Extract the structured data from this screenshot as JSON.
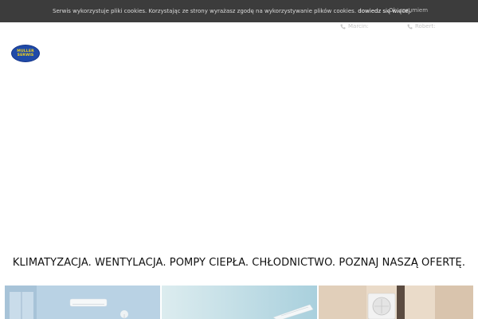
{
  "cookie_bar": {
    "text": "Serwis wykorzystuje pliki cookies. Korzystając ze strony wyrażasz zgodę na wykorzystywanie plików cookies.",
    "link_label": "dowiedz się więcej.",
    "ok_label": "Ok, rozumiem"
  },
  "header": {
    "logo_line1": "MULLER",
    "logo_line2": "SERWIS",
    "contacts": [
      {
        "label": "Marcin:"
      },
      {
        "label": "Robert:"
      }
    ]
  },
  "hero": {
    "tagline": "KLIMATYZACJA. WENTYLACJA. POMPY CIEPŁA. CHŁODNICTWO. POZNAJ NASZĄ OFERTĘ."
  },
  "gallery": {
    "items": [
      {
        "icon": "air-conditioner-room-photo"
      },
      {
        "icon": "wall-mounted-ac-photo"
      },
      {
        "icon": "heat-pump-photo"
      }
    ]
  },
  "colors": {
    "cookie_bg": "#3c3c3c",
    "logo_blue": "#1f4aa8",
    "logo_yellow": "#f2d21b"
  }
}
